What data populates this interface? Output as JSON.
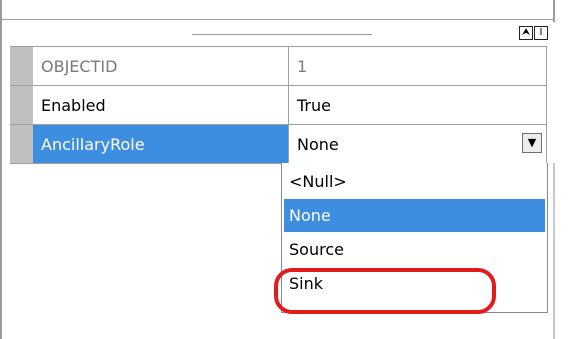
{
  "toolbar": {
    "sort_icon_glyph": "⮝",
    "info_icon_glyph": "I"
  },
  "properties": [
    {
      "name": "OBJECTID",
      "value": "1",
      "readonly": true
    },
    {
      "name": "Enabled",
      "value": "True",
      "readonly": false
    },
    {
      "name": "AncillaryRole",
      "value": "None",
      "readonly": false
    }
  ],
  "dropdown": {
    "dropdown_icon": "chevron-down-icon",
    "dropdown_glyph": "▼",
    "options": [
      "<Null>",
      "None",
      "Source",
      "Sink"
    ],
    "selected": "None"
  },
  "annotation": {
    "color": "#e21c1c"
  },
  "colors": {
    "selection": "#3d8ee0",
    "gutter": "#c0c0c0"
  }
}
